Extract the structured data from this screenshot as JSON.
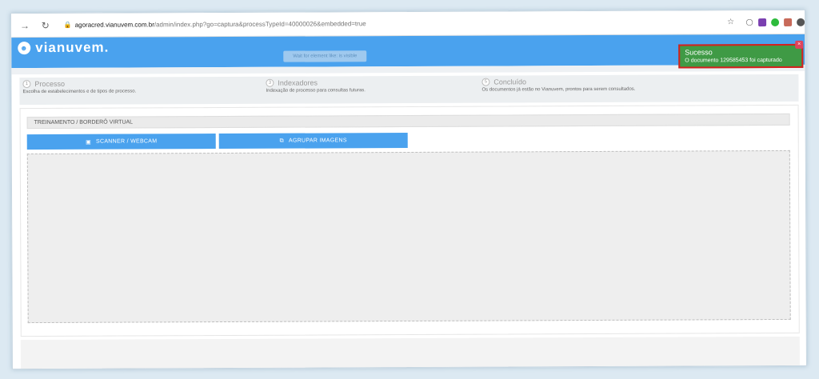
{
  "browser": {
    "url_host": "agoracred.vianuvem.com.br",
    "url_path": "/admin/index.php?go=captura&processTypeId=40000026&embedded=true"
  },
  "app": {
    "logo_text": "vianuvem.",
    "hint_text": "Wait for element like: is visible"
  },
  "toast": {
    "title": "Sucesso",
    "message": "O documento 129585453 foi capturado",
    "close_label": "×"
  },
  "steps": [
    {
      "num": "1",
      "title": "Processo",
      "desc": "Escolha de estabelecimentos e de tipos de processo."
    },
    {
      "num": "3",
      "title": "Indexadores",
      "desc": "Indexação de processo para consultas futuras."
    },
    {
      "num": "5",
      "title": "Concluído",
      "desc": "Os documentos já estão no Vianuvem, prontos para serem consultados."
    }
  ],
  "panel": {
    "title": "TREINAMENTO / BORDERÔ VIRTUAL",
    "scanner_label": "SCANNER / WEBCAM",
    "agrupar_label": "AGRUPAR IMAGENS"
  },
  "colors": {
    "header": "#4aa2ee",
    "toast": "#3f9a45",
    "highlight": "#d61f1f"
  }
}
